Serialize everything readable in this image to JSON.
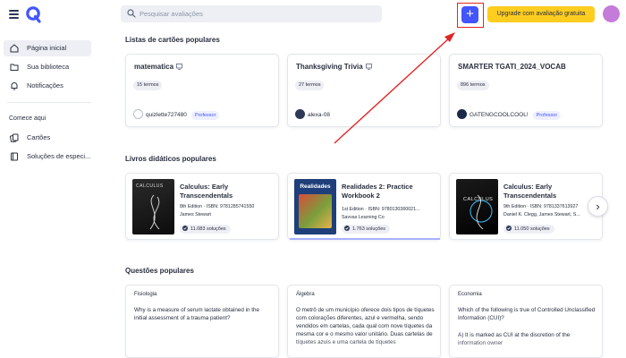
{
  "search": {
    "placeholder": "Pesquisar avaliações"
  },
  "header": {
    "upgrade_label": "Upgrade com avaliação gratuita"
  },
  "sidebar": {
    "items": [
      {
        "label": "Página inicial",
        "icon": "home-icon"
      },
      {
        "label": "Sua biblioteca",
        "icon": "folder-icon"
      },
      {
        "label": "Notificações",
        "icon": "bell-icon"
      }
    ],
    "section_heading": "Comece aqui",
    "start_items": [
      {
        "label": "Cartões",
        "icon": "cards-icon"
      },
      {
        "label": "Soluções de especi...",
        "icon": "book-icon"
      }
    ]
  },
  "sections": {
    "sets": "Listas de cartões populares",
    "books": "Livros didáticos populares",
    "questions": "Questões populares"
  },
  "sets": [
    {
      "title": "matematica",
      "terms": "15 termos",
      "user": "quizlette727480",
      "badge": "Professor"
    },
    {
      "title": "Thanksgiving Trivia",
      "terms": "27 termos",
      "user": "alexa-08",
      "badge": ""
    },
    {
      "title": "SMARTER TGATI_2024_VOCAB",
      "terms": "896 termos",
      "user": "GATENGCOOLCOOL!",
      "badge": "Professor"
    }
  ],
  "books": [
    {
      "title": "Calculus: Early Transcendentals",
      "edition": "8th Edition · ISBN: 9781285741550",
      "author": "James Stewart",
      "solutions": "11.083 soluções",
      "cover_text": "CALCULUS"
    },
    {
      "title": "Realidades 2: Practice Workbook 2",
      "edition": "1st Edition · ISBN: 9780130360021...",
      "author": "Savvas Learning Co",
      "solutions": "1.763 soluções",
      "cover_text": "Realidades"
    },
    {
      "title": "Calculus: Early Transcendentals",
      "edition": "9th Edition · ISBN: 9781337613927",
      "author": "Daniel K. Clegg, James Stewart, S...",
      "solutions": "11.050 soluções",
      "cover_text": "CALCULUS"
    }
  ],
  "questions": [
    {
      "subject": "Fisiologia",
      "text": "Why is a measure of serum lactate obtained in the initial assessment of a trauma patient?",
      "text2": ""
    },
    {
      "subject": "Álgebra",
      "text": "O metrô de um município oferece dois tipos de tíquetes com colorações diferentes, azul e vermelha, sendo vendidos em cartelas, cada qual com nove tíquetes da mesma cor e o mesmo valor unitário. Duas cartelas de tíquetes azuis e uma cartela de tíquetes",
      "text2": ""
    },
    {
      "subject": "Economia",
      "text": "Which of the following is true of Controlled Unclassified Information (CUI)?",
      "text2": "A) It is marked as CUI at the discretion of the information owner"
    }
  ],
  "colors": {
    "accent": "#4255ff",
    "upgrade": "#ffcd1f",
    "highlight_box": "#e02525",
    "avatar": "#c57bd9"
  }
}
